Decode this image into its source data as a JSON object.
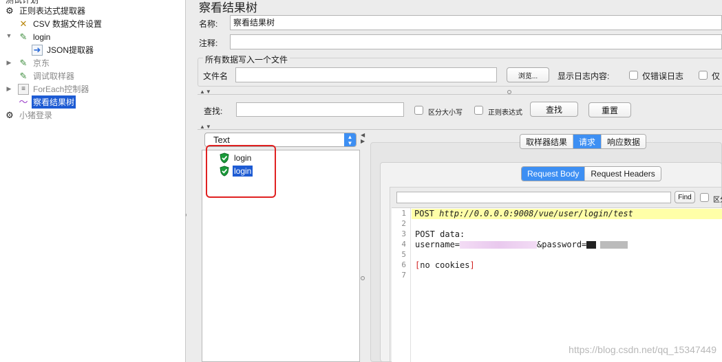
{
  "tree": {
    "top_cut_label": "测试计划",
    "items": [
      {
        "label": "正则表达式提取器",
        "icon": "gear-icon"
      },
      {
        "label": "CSV 数据文件设置",
        "icon": "wrench-icon"
      },
      {
        "label": "login",
        "icon": "pipette-icon"
      },
      {
        "label": "JSON提取器",
        "icon": "extractor-icon"
      },
      {
        "label": "京东",
        "icon": "pipette-icon"
      },
      {
        "label": "调试取样器",
        "icon": "pipette-icon"
      },
      {
        "label": "ForEach控制器",
        "icon": "controller-icon"
      },
      {
        "label": "察看结果树",
        "icon": "chart-icon"
      },
      {
        "label": "小猪登录",
        "icon": "gear-icon"
      }
    ]
  },
  "panel": {
    "title": "察看结果树",
    "name_label": "名称:",
    "name_value": "察看结果树",
    "comment_label": "注释:",
    "comment_value": "",
    "file_group_title": "所有数据写入一个文件",
    "filename_label": "文件名",
    "filename_value": "",
    "browse_button": "浏览...",
    "log_label": "显示日志内容:",
    "errors_only_label": "仅错误日志",
    "success_only_label": "仅"
  },
  "search": {
    "label": "查找:",
    "value": "",
    "case_label": "区分大小写",
    "regex_label": "正则表达式",
    "find_button": "查找",
    "reset_button": "重置"
  },
  "results": {
    "renderer_selected": "Text",
    "items": [
      {
        "label": "login",
        "status": "success"
      },
      {
        "label": "login",
        "status": "success",
        "selected": true
      }
    ]
  },
  "detail": {
    "tabs": [
      "取样器结果",
      "请求",
      "响应数据"
    ],
    "active_tab": "请求",
    "subtabs": [
      "Request Body",
      "Request Headers"
    ],
    "active_subtab": "Request Body",
    "find_value": "",
    "find_button": "Find",
    "find_case_label": "区分",
    "line_numbers": [
      "1",
      "2",
      "3",
      "4",
      "5",
      "6",
      "7"
    ],
    "lines": {
      "l1_method": "POST ",
      "l1_url": "http://0.0.0.0:9008/vue/user/login/test",
      "l3": "POST data:",
      "l4_a": "username=",
      "l4_b": "&password=",
      "l6": "[no cookies]"
    }
  },
  "watermark": "https://blog.csdn.net/qq_15347449",
  "colors": {
    "selection": "#1d5bd3",
    "active_tab": "#3d8ff3",
    "annotation": "#e02020",
    "highlight_line": "#ffffa8"
  }
}
